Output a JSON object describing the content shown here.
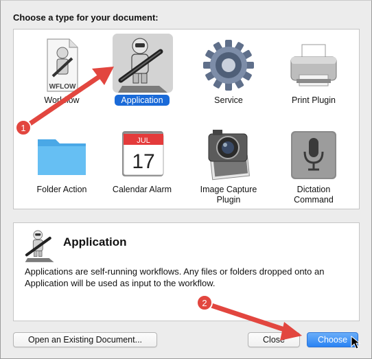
{
  "dialog": {
    "heading": "Choose a type for your document:",
    "types": [
      {
        "label": "Workflow",
        "icon": "workflow-document-icon",
        "file_tag": "WFLOW"
      },
      {
        "label": "Application",
        "icon": "automator-robot-icon",
        "selected": true
      },
      {
        "label": "Service",
        "icon": "gear-icon"
      },
      {
        "label": "Print Plugin",
        "icon": "printer-icon"
      },
      {
        "label": "Folder Action",
        "icon": "folder-icon"
      },
      {
        "label": "Calendar Alarm",
        "icon": "calendar-icon",
        "month": "JUL",
        "day": "17"
      },
      {
        "label": "Image Capture Plugin",
        "label_line1": "Image Capture",
        "label_line2": "Plugin",
        "icon": "camera-icon"
      },
      {
        "label": "Dictation Command",
        "label_line1": "Dictation",
        "label_line2": "Command",
        "icon": "microphone-icon"
      }
    ],
    "description": {
      "title": "Application",
      "text": "Applications are self-running workflows. Any files or folders dropped onto an Application will be used as input to the workflow."
    },
    "buttons": {
      "open_existing": "Open an Existing Document...",
      "close": "Close",
      "choose": "Choose"
    }
  },
  "annotations": {
    "step1": "1",
    "step2": "2",
    "arrow_color": "#e2463f"
  },
  "colors": {
    "selection_blue": "#1a6ad8",
    "primary_button": "#2a83f3",
    "folder_blue": "#5ab8f0"
  }
}
